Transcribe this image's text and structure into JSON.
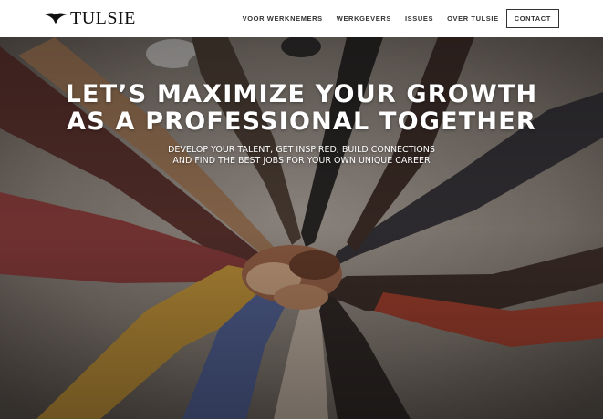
{
  "header": {
    "logo_text": "TULSIE",
    "logo_icon": "eagle-icon"
  },
  "nav": {
    "items": [
      "VOOR WERKNEMERS",
      "WERKGEVERS",
      "ISSUES",
      "OVER TULSIE"
    ],
    "contact_label": "CONTACT"
  },
  "hero": {
    "headline_line1": "LET’S MAXIMIZE YOUR GROWTH",
    "headline_line2": "AS A PROFESSIONAL TOGETHER",
    "sub_line1": "DEVELOP YOUR TALENT, GET INSPIRED, BUILD CONNECTIONS",
    "sub_line2": "AND FIND THE BEST JOBS FOR YOUR OWN UNIQUE CAREER",
    "image": "hands-stacked-together-photo"
  },
  "colors": {
    "header_bg": "#ffffff",
    "nav_text": "#333333",
    "hero_text": "#ffffff",
    "overlay": "#2a2420"
  }
}
